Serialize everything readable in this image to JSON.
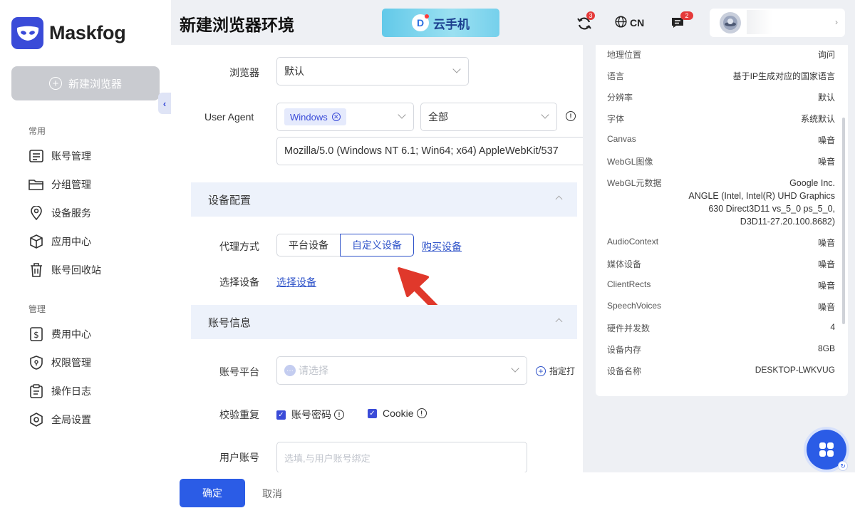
{
  "colors": {
    "brand": "#3a4bd8",
    "primary": "#2b5ce6",
    "section_bg": "#edf2fb",
    "arrow": "#e0382b"
  },
  "sidebar": {
    "logo_text": "Maskfog",
    "new_browser_label": "新建浏览器",
    "common_title": "常用",
    "common_items": [
      {
        "label": "账号管理",
        "icon": "account-list-icon"
      },
      {
        "label": "分组管理",
        "icon": "folder-icon"
      },
      {
        "label": "设备服务",
        "icon": "location-pin-icon"
      },
      {
        "label": "应用中心",
        "icon": "cube-icon"
      },
      {
        "label": "账号回收站",
        "icon": "trash-icon"
      }
    ],
    "manage_title": "管理",
    "manage_items": [
      {
        "label": "费用中心",
        "icon": "dollar-icon"
      },
      {
        "label": "权限管理",
        "icon": "shield-icon"
      },
      {
        "label": "操作日志",
        "icon": "clipboard-icon"
      },
      {
        "label": "全局设置",
        "icon": "gear-icon"
      }
    ]
  },
  "header": {
    "title": "新建浏览器环境",
    "banner_text": "云手机",
    "sync_badge": "3",
    "language": "CN",
    "message_badge": "2"
  },
  "form": {
    "browser_label": "浏览器",
    "browser_value": "默认",
    "ua_label": "User Agent",
    "ua_os_tag": "Windows",
    "ua_version_value": "全部",
    "ua_string": "Mozilla/5.0 (Windows NT 6.1; Win64; x64) AppleWebKit/537",
    "device_section": "设备配置",
    "proxy_label": "代理方式",
    "proxy_options": [
      "平台设备",
      "自定义设备"
    ],
    "proxy_selected": "自定义设备",
    "buy_device_link": "购买设备",
    "select_device_label": "选择设备",
    "select_device_link": "选择设备",
    "account_section": "账号信息",
    "platform_label": "账号平台",
    "platform_placeholder": "请选择",
    "specify_open": "指定打",
    "verify_label": "校验重复",
    "verify_password": "账号密码",
    "verify_cookie": "Cookie",
    "user_account_label": "用户账号",
    "user_account_placeholder": "选填,与用户账号绑定"
  },
  "fingerprint": [
    {
      "key": "地理位置",
      "value": "询问"
    },
    {
      "key": "语言",
      "value": "基于IP生成对应的国家语言"
    },
    {
      "key": "分辨率",
      "value": "默认"
    },
    {
      "key": "字体",
      "value": "系统默认"
    },
    {
      "key": "Canvas",
      "value": "噪音"
    },
    {
      "key": "WebGL图像",
      "value": "噪音"
    },
    {
      "key": "WebGL元数据",
      "value_lines": [
        "Google Inc.",
        "ANGLE (Intel, Intel(R) UHD Graphics",
        "630 Direct3D11 vs_5_0 ps_5_0,",
        "D3D11-27.20.100.8682)"
      ]
    },
    {
      "key": "AudioContext",
      "value": "噪音"
    },
    {
      "key": "媒体设备",
      "value": "噪音"
    },
    {
      "key": "ClientRects",
      "value": "噪音"
    },
    {
      "key": "SpeechVoices",
      "value": "噪音"
    },
    {
      "key": "硬件并发数",
      "value": "4"
    },
    {
      "key": "设备内存",
      "value": "8GB"
    },
    {
      "key": "设备名称",
      "value": "DESKTOP-LWKVUG"
    }
  ],
  "footer": {
    "confirm": "确定",
    "cancel": "取消"
  }
}
